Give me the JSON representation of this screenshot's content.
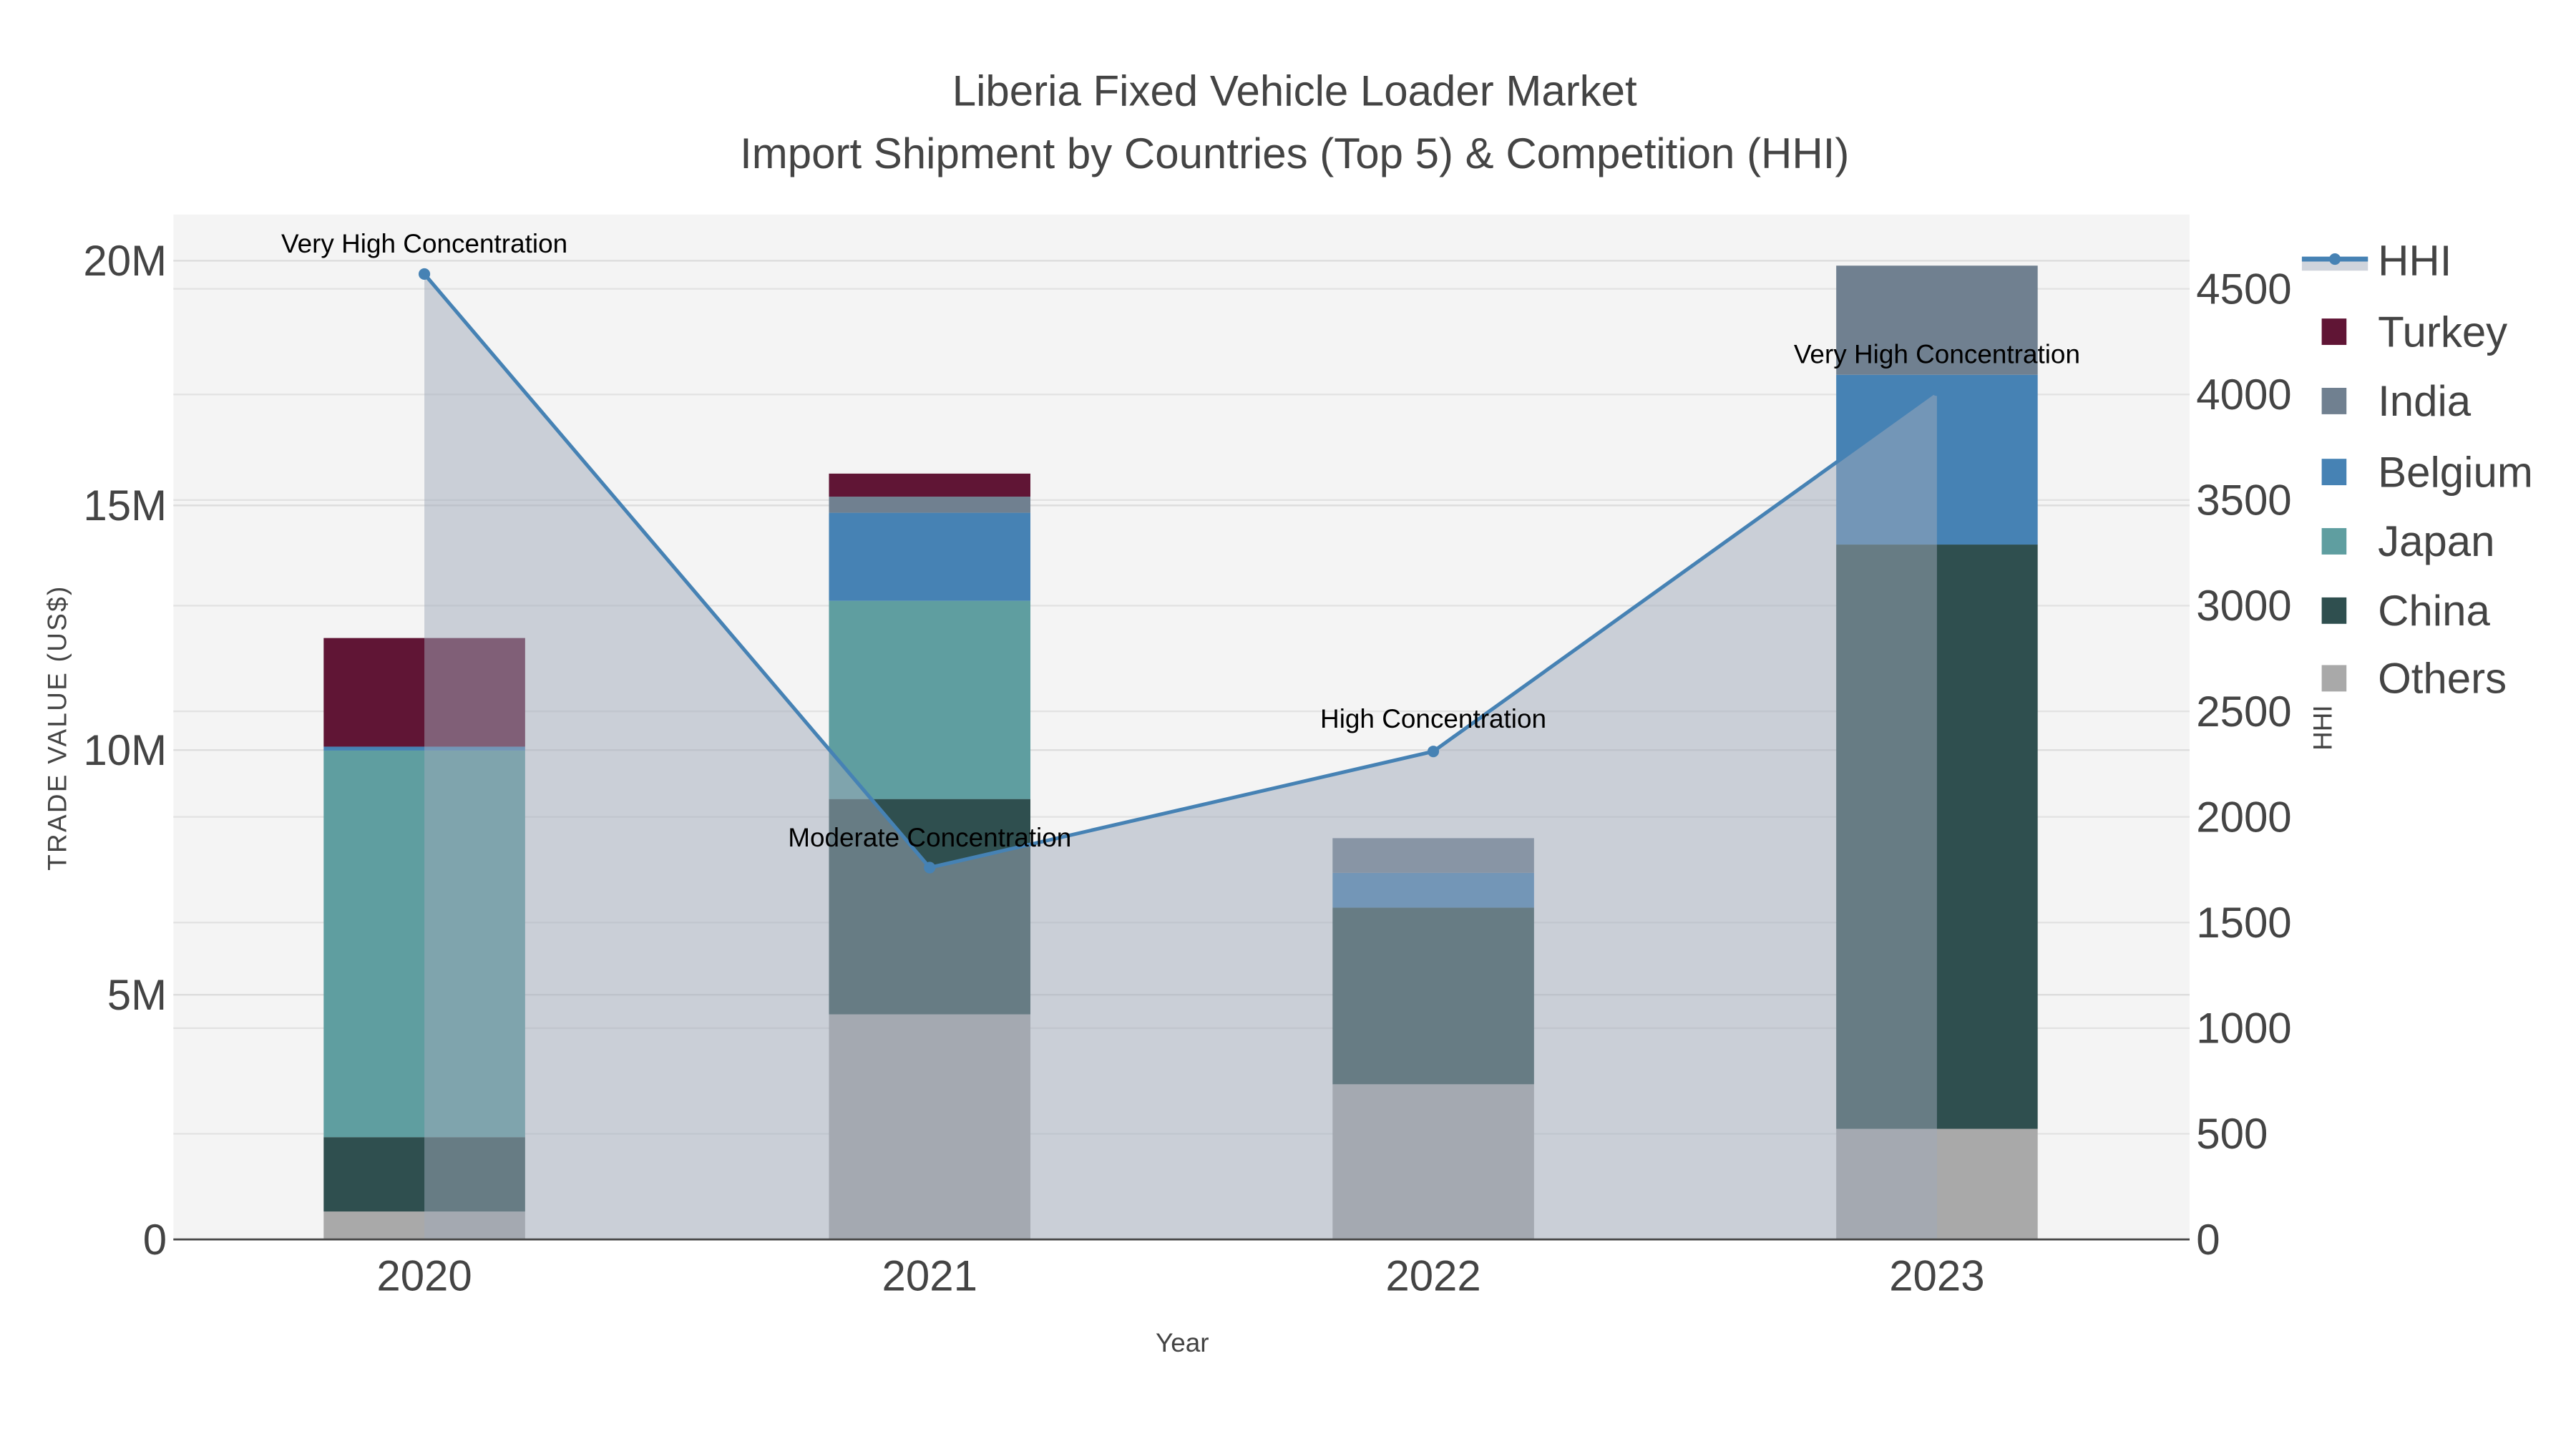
{
  "chart_data": {
    "type": "bar",
    "mode": "stacked",
    "title": "Liberia Fixed Vehicle Loader Market",
    "subtitle": "Import Shipment by Countries (Top 5) & Competition (HHI)",
    "xlabel": "Year",
    "ylabel": "TRADE VALUE (US$)",
    "y2label": "HHI",
    "categories": [
      "2020",
      "2021",
      "2022",
      "2023"
    ],
    "ylim": [
      0,
      21000000
    ],
    "y_ticks": [
      0,
      5000000,
      10000000,
      15000000,
      20000000
    ],
    "y_tick_labels": [
      "0",
      "5M",
      "10M",
      "15M",
      "20M"
    ],
    "y2lim": [
      0,
      4850
    ],
    "y2_ticks": [
      0,
      500,
      1000,
      1500,
      2000,
      2500,
      3000,
      3500,
      4000,
      4500
    ],
    "y2_tick_labels": [
      "0",
      "500",
      "1000",
      "1500",
      "2000",
      "2500",
      "3000",
      "3500",
      "4000",
      "4500"
    ],
    "grid": true,
    "legend_position": "right",
    "series": [
      {
        "name": "Others",
        "color": "#a9a9a9",
        "values": [
          570000,
          4600000,
          3170000,
          2260000
        ]
      },
      {
        "name": "China",
        "color": "#2f4f4f",
        "values": [
          1520000,
          4400000,
          3610000,
          11940000
        ]
      },
      {
        "name": "Japan",
        "color": "#5f9ea0",
        "values": [
          7900000,
          4050000,
          0,
          0
        ]
      },
      {
        "name": "Belgium",
        "color": "#4682b4",
        "values": [
          80000,
          1800000,
          710000,
          3470000
        ]
      },
      {
        "name": "India",
        "color": "#708090",
        "values": [
          0,
          330000,
          710000,
          2230000
        ]
      },
      {
        "name": "Turkey",
        "color": "#601535",
        "values": [
          2220000,
          470000,
          0,
          0
        ]
      }
    ],
    "hhi": {
      "name": "HHI",
      "color": "#4682b4",
      "values": [
        4570,
        1760,
        2310,
        4020
      ],
      "annotations": [
        "Very High Concentration",
        "Moderate Concentration",
        "High Concentration",
        "Very High Concentration"
      ]
    },
    "legend_order": [
      "HHI",
      "Turkey",
      "India",
      "Belgium",
      "Japan",
      "China",
      "Others"
    ]
  }
}
